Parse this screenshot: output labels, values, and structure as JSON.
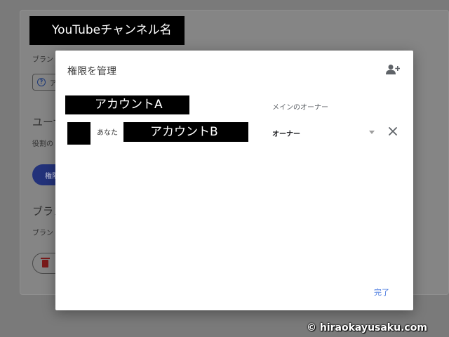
{
  "background": {
    "channel_name": "YouTubeチャンネル名",
    "brand_text": "ブランド",
    "chip_label": "ア",
    "users_heading": "ユーザー",
    "roles_text": "役割の",
    "manage_button": "権限",
    "brand_heading": "ブランド",
    "brand_text_2": "ブランド",
    "accent_color": "#23327a"
  },
  "dialog": {
    "title": "権限を管理",
    "add_user_icon": "person-add-icon",
    "owner": {
      "account_label": "アカウントA",
      "role_label": "メインのオーナー"
    },
    "users": [
      {
        "you_label": "あなた",
        "account_label": "アカウントB",
        "role": "オーナー",
        "remove_icon": "close-icon"
      }
    ],
    "done_label": "完了",
    "done_color": "#4d7de0"
  },
  "watermark": "© hiraokayusaku.com"
}
